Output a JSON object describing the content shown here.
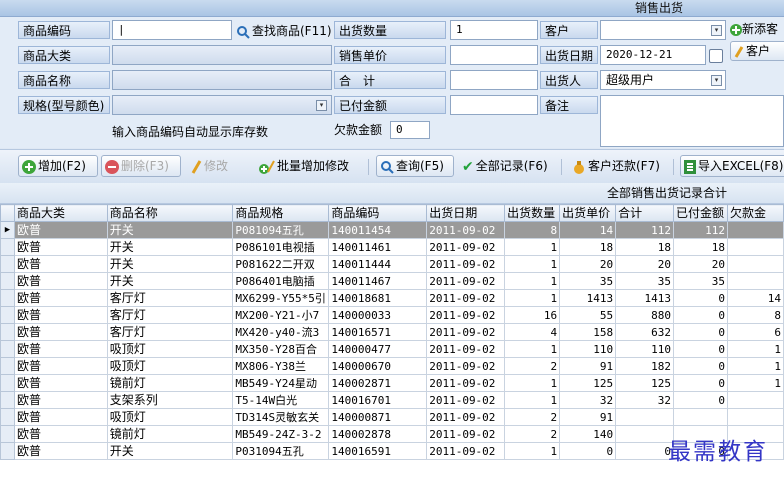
{
  "window": {
    "title": "销售出货"
  },
  "form": {
    "product_code_label": "商品编码",
    "find_product_button": "查找商品(F11)",
    "out_qty_label": "出货数量",
    "out_qty_value": "1",
    "customer_label": "客户",
    "customer_value": "",
    "add_customer_button": "新添客",
    "customer_button": "客户",
    "category_label": "商品大类",
    "unit_price_label": "销售单价",
    "out_date_label": "出货日期",
    "out_date_value": "2020-12-21",
    "product_name_label": "商品名称",
    "total_label": "合　计",
    "operator_label": "出货人",
    "operator_value": "超级用户",
    "spec_label": "规格(型号颜色)",
    "paid_label": "已付金额",
    "remark_label": "备注",
    "hint_text": "输入商品编码自动显示库存数",
    "owed_label": "欠款金额",
    "owed_value": "0"
  },
  "toolbar": {
    "add": "增加(F2)",
    "delete": "删除(F3)",
    "edit": "修改",
    "batch": "批量增加修改",
    "query": "查询(F5)",
    "all_records": "全部记录(F6)",
    "customer_payment": "客户还款(F7)",
    "export": "导入EXCEL(F8)"
  },
  "grid": {
    "summary_title": "全部销售出货记录合计",
    "columns": [
      "商品大类",
      "商品名称",
      "商品规格",
      "商品编码",
      "出货日期",
      "出货数量",
      "出货单价",
      "合计",
      "已付金额",
      "欠款金"
    ],
    "rows": [
      [
        "欧普",
        "开关",
        "P081094五孔",
        "140011454",
        "2011-09-02",
        "8",
        "14",
        "112",
        "112",
        ""
      ],
      [
        "欧普",
        "开关",
        "P086101电视插",
        "140011461",
        "2011-09-02",
        "1",
        "18",
        "18",
        "18",
        ""
      ],
      [
        "欧普",
        "开关",
        "P081622二开双",
        "140011444",
        "2011-09-02",
        "1",
        "20",
        "20",
        "20",
        ""
      ],
      [
        "欧普",
        "开关",
        "P086401电脑插",
        "140011467",
        "2011-09-02",
        "1",
        "35",
        "35",
        "35",
        ""
      ],
      [
        "欧普",
        "客厅灯",
        "MX6299-Y55*5引",
        "140018681",
        "2011-09-02",
        "1",
        "1413",
        "1413",
        "0",
        "14"
      ],
      [
        "欧普",
        "客厅灯",
        "MX200-Y21-小7",
        "140000033",
        "2011-09-02",
        "16",
        "55",
        "880",
        "0",
        "8"
      ],
      [
        "欧普",
        "客厅灯",
        "MX420-y40-流3",
        "140016571",
        "2011-09-02",
        "4",
        "158",
        "632",
        "0",
        "6"
      ],
      [
        "欧普",
        "吸顶灯",
        "MX350-Y28百合",
        "140000477",
        "2011-09-02",
        "1",
        "110",
        "110",
        "0",
        "1"
      ],
      [
        "欧普",
        "吸顶灯",
        "MX806-Y38兰",
        "140000670",
        "2011-09-02",
        "2",
        "91",
        "182",
        "0",
        "1"
      ],
      [
        "欧普",
        "镜前灯",
        "MB549-Y24星动",
        "140002871",
        "2011-09-02",
        "1",
        "125",
        "125",
        "0",
        "1"
      ],
      [
        "欧普",
        "支架系列",
        "T5-14W白光",
        "140016701",
        "2011-09-02",
        "1",
        "32",
        "32",
        "0",
        ""
      ],
      [
        "欧普",
        "吸顶灯",
        "TD314S灵敏玄关",
        "140000871",
        "2011-09-02",
        "2",
        "91",
        "",
        "",
        ""
      ],
      [
        "欧普",
        "镜前灯",
        "MB549-24Z-3-2",
        "140002878",
        "2011-09-02",
        "2",
        "140",
        "",
        "",
        ""
      ],
      [
        "欧普",
        "开关",
        "P031094五孔",
        "140016591",
        "2011-09-02",
        "1",
        "0",
        "0",
        "0",
        ""
      ]
    ]
  },
  "watermark": "最需教育"
}
